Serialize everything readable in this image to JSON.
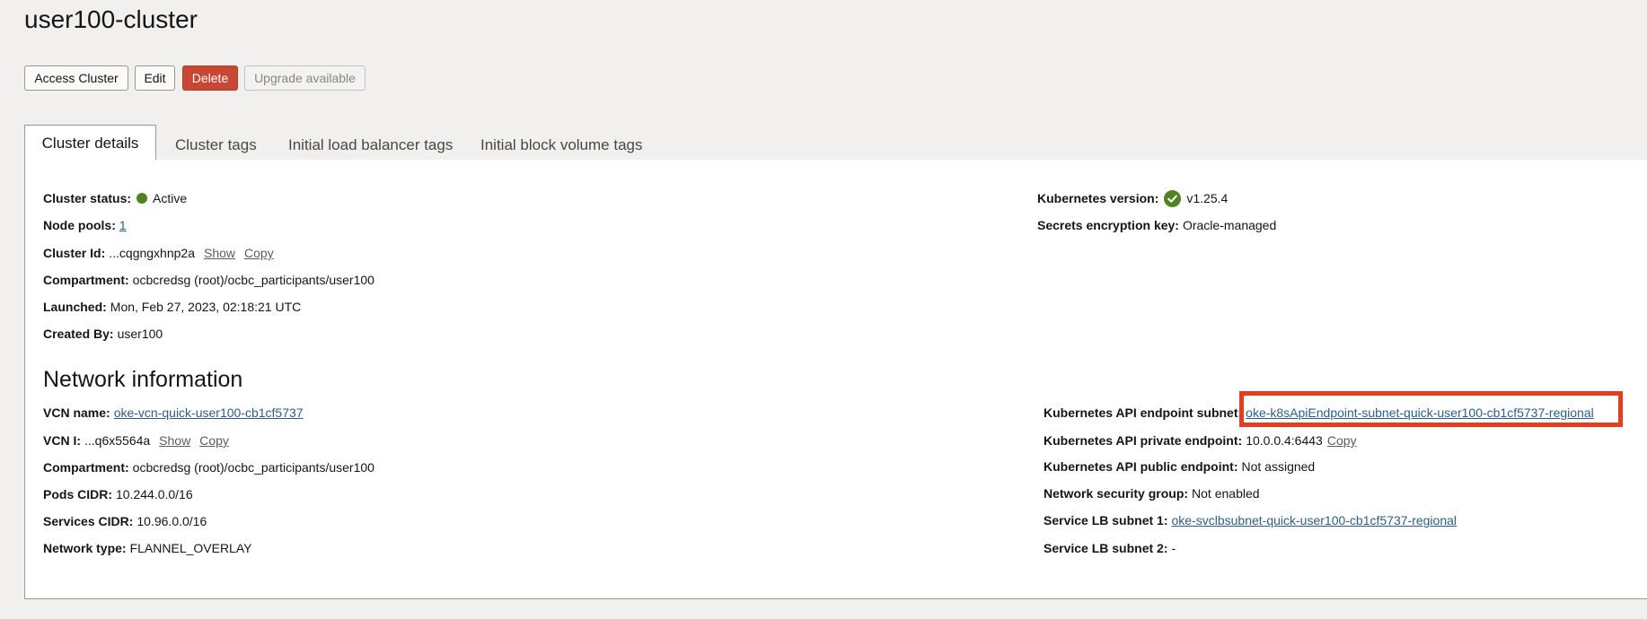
{
  "page": {
    "title": "user100-cluster"
  },
  "actions": {
    "access_cluster": "Access Cluster",
    "edit": "Edit",
    "delete": "Delete",
    "upgrade": "Upgrade available"
  },
  "tabs": [
    {
      "label": "Cluster details",
      "active": true
    },
    {
      "label": "Cluster tags",
      "active": false
    },
    {
      "label": "Initial load balancer tags",
      "active": false
    },
    {
      "label": "Initial block volume tags",
      "active": false
    }
  ],
  "cluster_details": {
    "status_label": "Cluster status:",
    "status_value": "Active",
    "status_color": "#508223",
    "node_pools_label": "Node pools:",
    "node_pools_value": "1",
    "cluster_id_label": "Cluster Id:",
    "cluster_id_value": "...cqgngxhnp2a",
    "show": "Show",
    "copy": "Copy",
    "compartment_label": "Compartment:",
    "compartment_value": "ocbcredsg (root)/ocbc_participants/user100",
    "launched_label": "Launched:",
    "launched_value": "Mon, Feb 27, 2023, 02:18:21 UTC",
    "created_by_label": "Created By:",
    "created_by_value": "user100",
    "k8s_version_label": "Kubernetes version:",
    "k8s_version_value": "v1.25.4",
    "secrets_label": "Secrets encryption key:",
    "secrets_value": "Oracle-managed"
  },
  "network": {
    "title": "Network information",
    "vcn_name_label": "VCN name:",
    "vcn_name_value": "oke-vcn-quick-user100-cb1cf5737",
    "vcn_id_label": "VCN I:",
    "vcn_id_value": "...q6x5564a",
    "show": "Show",
    "copy": "Copy",
    "compartment_label": "Compartment:",
    "compartment_value": "ocbcredsg (root)/ocbc_participants/user100",
    "pods_cidr_label": "Pods CIDR:",
    "pods_cidr_value": "10.244.0.0/16",
    "services_cidr_label": "Services CIDR:",
    "services_cidr_value": "10.96.0.0/16",
    "network_type_label": "Network type:",
    "network_type_value": "FLANNEL_OVERLAY",
    "api_subnet_label": "Kubernetes API endpoint subnet:",
    "api_subnet_value": "oke-k8sApiEndpoint-subnet-quick-user100-cb1cf5737-regional",
    "api_private_label": "Kubernetes API private endpoint:",
    "api_private_value": "10.0.0.4:6443",
    "api_private_copy": "Copy",
    "api_public_label": "Kubernetes API public endpoint:",
    "api_public_value": "Not assigned",
    "nsg_label": "Network security group:",
    "nsg_value": "Not enabled",
    "lb1_label": "Service LB subnet 1:",
    "lb1_value": "oke-svclbsubnet-quick-user100-cb1cf5737-regional",
    "lb2_label": "Service LB subnet 2:",
    "lb2_value": "-"
  },
  "colors": {
    "accent_danger": "#c74634",
    "link": "#2c5d8a",
    "highlight": "#e63c1f"
  }
}
